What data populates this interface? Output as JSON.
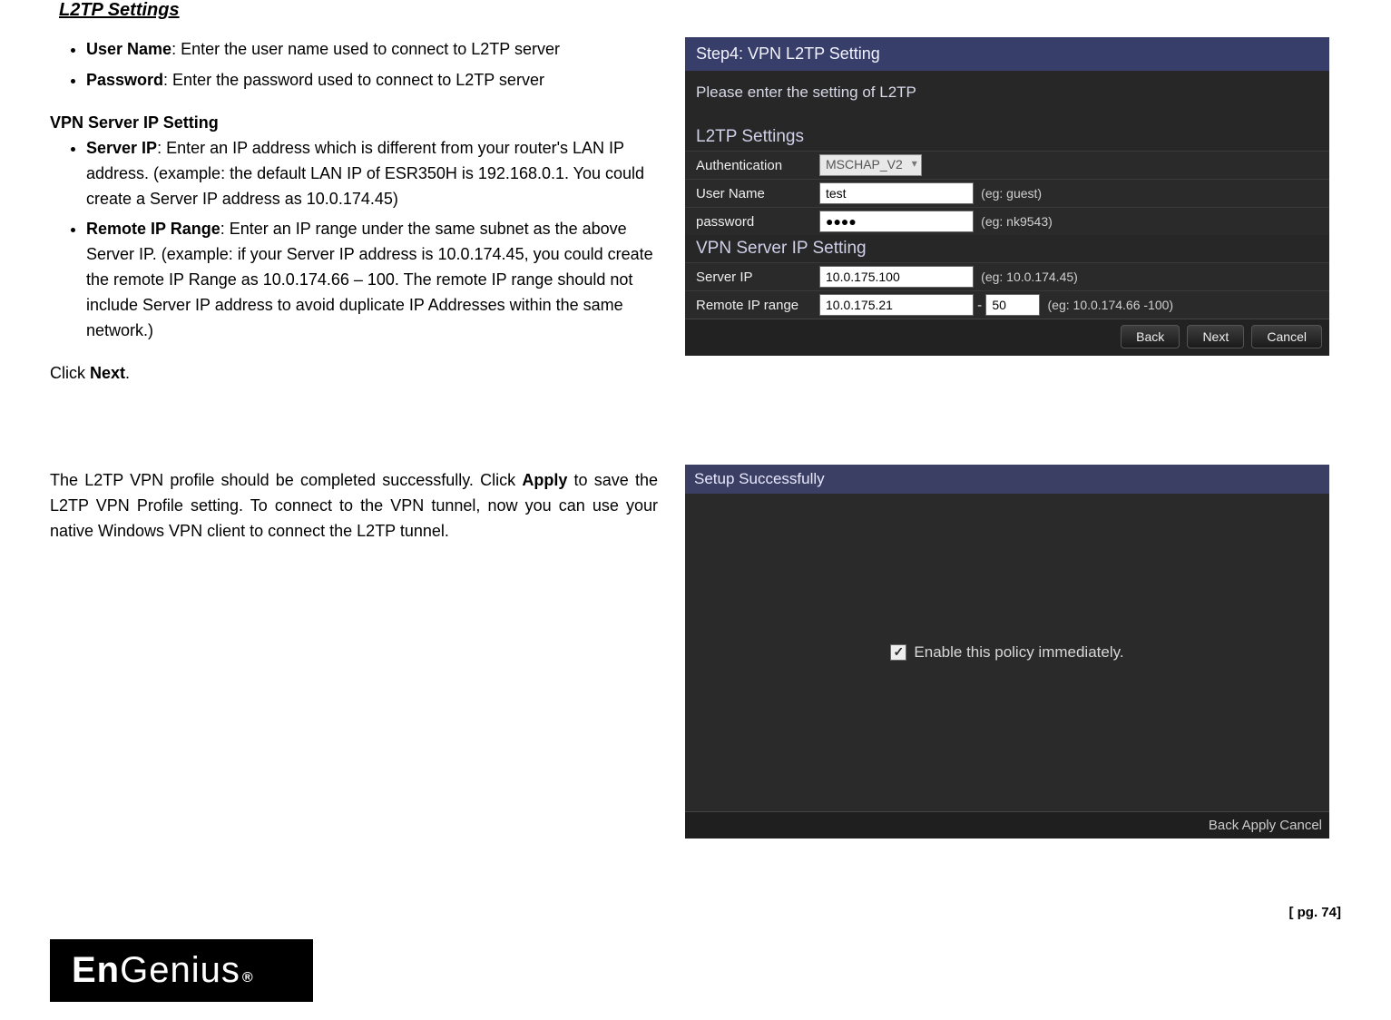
{
  "title": "L2TP Settings",
  "bullets1": [
    {
      "b": "User Name",
      "t": ": Enter the user name used to connect to L2TP server"
    },
    {
      "b": "Password",
      "t": ": Enter the password used to connect to L2TP server"
    }
  ],
  "subhead": "VPN Server IP Setting",
  "bullets2": [
    {
      "b": "Server IP",
      "t": ": Enter an IP address which is different from your router's LAN IP address. (example: the default LAN IP of ESR350H is 192.168.0.1. You could create a Server IP address as 10.0.174.45)"
    },
    {
      "b": "Remote IP Range",
      "t": ": Enter an IP range under the same subnet as the above Server IP. (example: if  your Server IP address is 10.0.174.45, you could create the remote IP Range as 10.0.174.66 – 100. The remote IP range should not include Server IP address to avoid duplicate IP Addresses within the same network.)"
    }
  ],
  "click_next_pre": "Click ",
  "click_next_b": "Next",
  "click_next_post": ".",
  "para2_pre": "The L2TP VPN profile should be completed successfully. Click ",
  "para2_b": "Apply",
  "para2_post": " to save the L2TP VPN Profile setting. To connect to the VPN tunnel, now you can use your native Windows VPN client to connect the L2TP tunnel.",
  "panelA": {
    "step": "Step4: VPN L2TP Setting",
    "sub": "Please enter the setting of L2TP",
    "sec1": "L2TP Settings",
    "authLabel": "Authentication",
    "authVal": "MSCHAP_V2",
    "userLabel": "User Name",
    "userVal": "test",
    "userHint": "(eg: guest)",
    "passLabel": "password",
    "passVal": "●●●●",
    "passHint": "(eg: nk9543)",
    "sec2": "VPN Server IP Setting",
    "srvLabel": "Server IP",
    "srvVal": "10.0.175.100",
    "srvHint": "(eg: 10.0.174.45)",
    "rangeLabel": "Remote IP range",
    "rangeVal1": "10.0.175.21",
    "rangeDash": "-",
    "rangeVal2": "50",
    "rangeHint": "(eg: 10.0.174.66 -100)",
    "back": "Back",
    "next": "Next",
    "cancel": "Cancel"
  },
  "panelB": {
    "hdr": "Setup Successfully",
    "chkLabel": "Enable this policy immediately.",
    "back": "Back",
    "apply": "Apply",
    "cancel": "Cancel"
  },
  "page": "[ pg. 74]",
  "logo_a": "En",
  "logo_b": "Genius",
  "logo_r": "®"
}
